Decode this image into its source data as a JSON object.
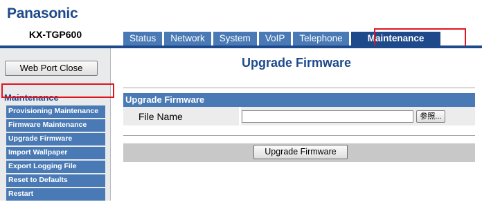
{
  "brand": {
    "logo": "Panasonic",
    "model": "KX-TGP600"
  },
  "tabs": [
    {
      "label": "Status"
    },
    {
      "label": "Network"
    },
    {
      "label": "System"
    },
    {
      "label": "VoIP"
    },
    {
      "label": "Telephone"
    },
    {
      "label": "Maintenance",
      "active": true
    }
  ],
  "sidebar": {
    "web_port_close": "Web Port Close",
    "heading": "Maintenance",
    "items": [
      {
        "label": "Provisioning Maintenance"
      },
      {
        "label": "Firmware Maintenance"
      },
      {
        "label": "Upgrade Firmware",
        "highlighted": true
      },
      {
        "label": "Import Wallpaper"
      },
      {
        "label": "Export Logging File"
      },
      {
        "label": "Reset to Defaults"
      },
      {
        "label": "Restart"
      }
    ]
  },
  "main": {
    "page_title": "Upgrade Firmware",
    "section_header": "Upgrade Firmware",
    "file_name_label": "File Name",
    "file_name_value": "",
    "browse_label": "参照...",
    "upgrade_button": "Upgrade Firmware"
  },
  "colors": {
    "brand_blue": "#1e4a8c",
    "tab_blue": "#4a7ab5",
    "highlight_red": "#e0141e"
  }
}
